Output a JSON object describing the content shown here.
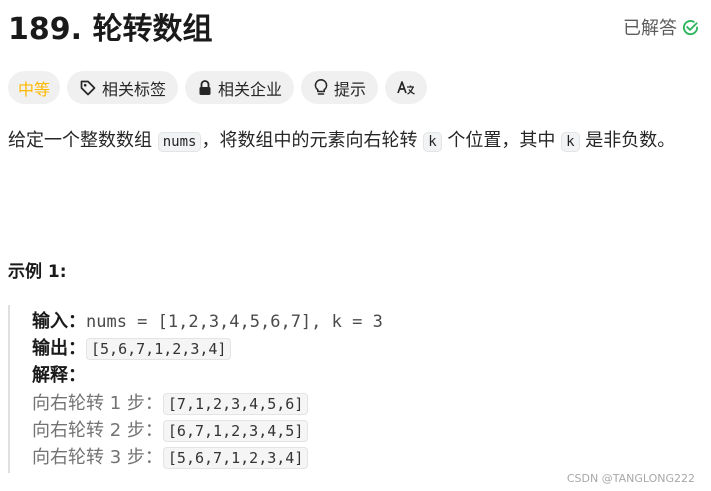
{
  "problem": {
    "title": "189. 轮转数组",
    "solved_label": "已解答"
  },
  "tags": {
    "difficulty": "中等",
    "related_tags": "相关标签",
    "related_companies": "相关企业",
    "hint": "提示",
    "translate_glyph": "Aあ"
  },
  "description": {
    "part1": "给定一个整数数组 ",
    "code1": "nums",
    "part2": "，将数组中的元素向右轮转 ",
    "code2": "k",
    "part3": " 个位置，其中 ",
    "code3": "k",
    "part4": " 是非负数。"
  },
  "example": {
    "title": "示例 1:",
    "input_label": "输入：",
    "input_value": "nums = [1,2,3,4,5,6,7], k = 3",
    "output_label": "输出：",
    "output_value": "[5,6,7,1,2,3,4]",
    "explain_label": "解释：",
    "steps": [
      {
        "label": "向右轮转 1 步：",
        "value": "[7,1,2,3,4,5,6]"
      },
      {
        "label": "向右轮转 2 步：",
        "value": "[6,7,1,2,3,4,5]"
      },
      {
        "label": "向右轮转 3 步：",
        "value": "[5,6,7,1,2,3,4]"
      }
    ]
  },
  "watermark": "CSDN @TANGLONG222",
  "colors": {
    "difficulty_medium": "#ffb800",
    "solved_check": "#2db55d"
  }
}
